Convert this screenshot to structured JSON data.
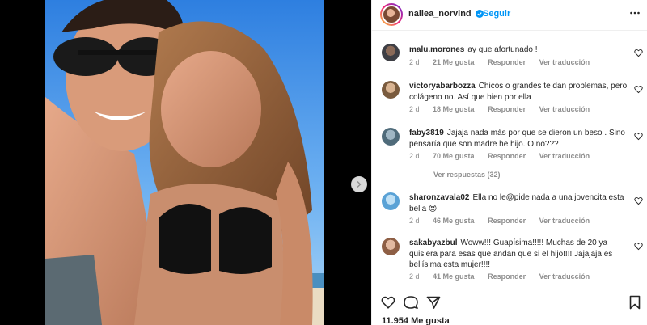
{
  "post": {
    "username": "nailea_norvind",
    "follow_label": "Seguir",
    "likes_text": "11.954 Me gusta"
  },
  "comments": [
    {
      "user": "malu.morones",
      "text": "ay que afortunado !",
      "time": "2 d",
      "likes": "21 Me gusta",
      "reply": "Responder",
      "translate": "Ver traducción"
    },
    {
      "user": "victoryabarbozza",
      "text": "Chicos o grandes te dan problemas, pero colágeno no. Así que bien por ella",
      "time": "2 d",
      "likes": "18 Me gusta",
      "reply": "Responder",
      "translate": "Ver traducción"
    },
    {
      "user": "faby3819",
      "text": "Jajaja nada más por que se dieron un beso . Sino pensaría que son madre he hijo. O no???",
      "time": "2 d",
      "likes": "70 Me gusta",
      "reply": "Responder",
      "translate": "Ver traducción"
    },
    {
      "user": "sharonzavala02",
      "text": "Ella no le@pide nada a una jovencita esta bella 😍",
      "time": "2 d",
      "likes": "46 Me gusta",
      "reply": "Responder",
      "translate": "Ver traducción"
    },
    {
      "user": "sakabyazbul",
      "text": "Woww!!! Guapísima!!!!! Muchas de 20 ya quisiera para esas que andan que si el hijo!!!! Jajajaja es bellísima esta mujer!!!!",
      "time": "2 d",
      "likes": "41 Me gusta",
      "reply": "Responder",
      "translate": "Ver traducción"
    }
  ],
  "view_replies": "Ver respuestas (32)",
  "icons": {
    "verified": "verified-badge-icon",
    "more": "more-options-icon",
    "like": "heart-icon",
    "comment": "comment-bubble-icon",
    "share": "paper-plane-icon",
    "save": "bookmark-icon",
    "next": "chevron-right-icon"
  },
  "colors": {
    "accent": "#0095f6",
    "muted": "#8e8e8e",
    "text": "#262626"
  }
}
